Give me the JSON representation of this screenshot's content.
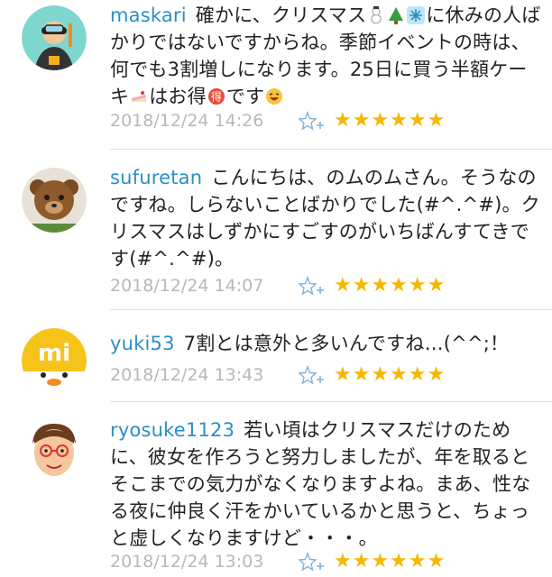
{
  "comments": [
    {
      "user": "maskari",
      "segments": [
        "確かに、クリスマス",
        "に休みの人ばかりではないですからね。季節イベントの時は、何でも3割増しになります。25日に買う半額ケーキ",
        "はお得",
        "です"
      ],
      "time": "2018/12/24 14:26",
      "stars": "★★★★★★"
    },
    {
      "user": "sufuretan",
      "segments": [
        "こんにちは、のムのムさん。そうなのですね。しらないことばかりでした(#^.^#)。クリスマスはしずかにすごすのがいちばんすてきです(#^.^#)。"
      ],
      "time": "2018/12/24 14:07",
      "stars": "★★★★★★"
    },
    {
      "user": "yuki53",
      "segments": [
        "7割とは意外と多いんですね…(^^;！"
      ],
      "time": "2018/12/24 13:43",
      "stars": "★★★★★★"
    },
    {
      "user": "ryosuke1123",
      "segments": [
        "若い頃はクリスマスだけのために、彼女を作ろうと努力しましたが、年を取るとそこまでの気力がなくなりますよね。まあ、性なる夜に仲良く汗をかいているかと思うと、ちょっと虚しくなりますけど・・・。"
      ],
      "time": "2018/12/24 13:03",
      "stars": "★★★★★★"
    }
  ],
  "avatar2_mark": "mi",
  "colors": {
    "username": "#2a8fc6",
    "star": "#f5b800",
    "meta": "#b8b8b8"
  },
  "icons": [
    "snowman-icon",
    "tree-icon",
    "snowflake-icon",
    "cake-icon",
    "toku-icon",
    "laughing-face-icon",
    "add-star-icon"
  ]
}
